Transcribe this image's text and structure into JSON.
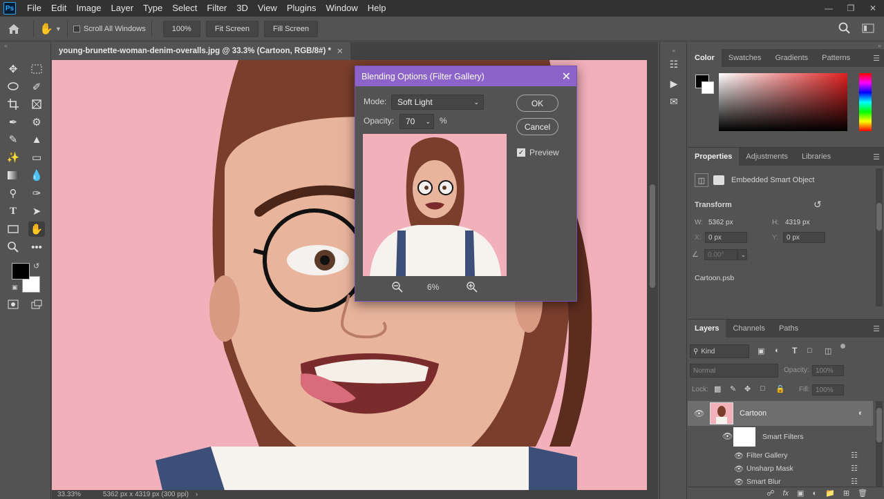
{
  "menu": {
    "logo": "Ps",
    "items": [
      "File",
      "Edit",
      "Image",
      "Layer",
      "Type",
      "Select",
      "Filter",
      "3D",
      "View",
      "Plugins",
      "Window",
      "Help"
    ]
  },
  "options": {
    "scroll_all": "Scroll All Windows",
    "zoom_btn": "100%",
    "fit_btn": "Fit Screen",
    "fill_btn": "Fill Screen"
  },
  "document": {
    "tab_title": "young-brunette-woman-denim-overalls.jpg @ 33.3% (Cartoon, RGB/8#) *",
    "status_zoom": "33.33%",
    "status_info": "5362 px x 4319 px (300 ppi)"
  },
  "dialog": {
    "title": "Blending Options (Filter Gallery)",
    "mode_label": "Mode:",
    "mode_value": "Soft Light",
    "opacity_label": "Opacity:",
    "opacity_value": "70",
    "opacity_unit": "%",
    "ok": "OK",
    "cancel": "Cancel",
    "preview_label": "Preview",
    "zoom_value": "6%"
  },
  "color_panel": {
    "tabs": [
      "Color",
      "Swatches",
      "Gradients",
      "Patterns"
    ]
  },
  "properties": {
    "tabs": [
      "Properties",
      "Adjustments",
      "Libraries"
    ],
    "object_type": "Embedded Smart Object",
    "transform_title": "Transform",
    "w_label": "W:",
    "w_value": "5362 px",
    "h_label": "H:",
    "h_value": "4319 px",
    "x_label": "X:",
    "x_value": "0 px",
    "y_label": "Y:",
    "y_value": "0 px",
    "angle_value": "0.00°",
    "linked_file": "Cartoon.psb"
  },
  "layers": {
    "tabs": [
      "Layers",
      "Channels",
      "Paths"
    ],
    "kind_placeholder": "Kind",
    "blend_mode": "Normal",
    "opacity_label": "Opacity:",
    "opacity_value": "100%",
    "lock_label": "Lock:",
    "fill_label": "Fill:",
    "fill_value": "100%",
    "layer_name": "Cartoon",
    "smart_filters": "Smart Filters",
    "filters": [
      "Filter Gallery",
      "Unsharp Mask",
      "Smart Blur"
    ]
  }
}
